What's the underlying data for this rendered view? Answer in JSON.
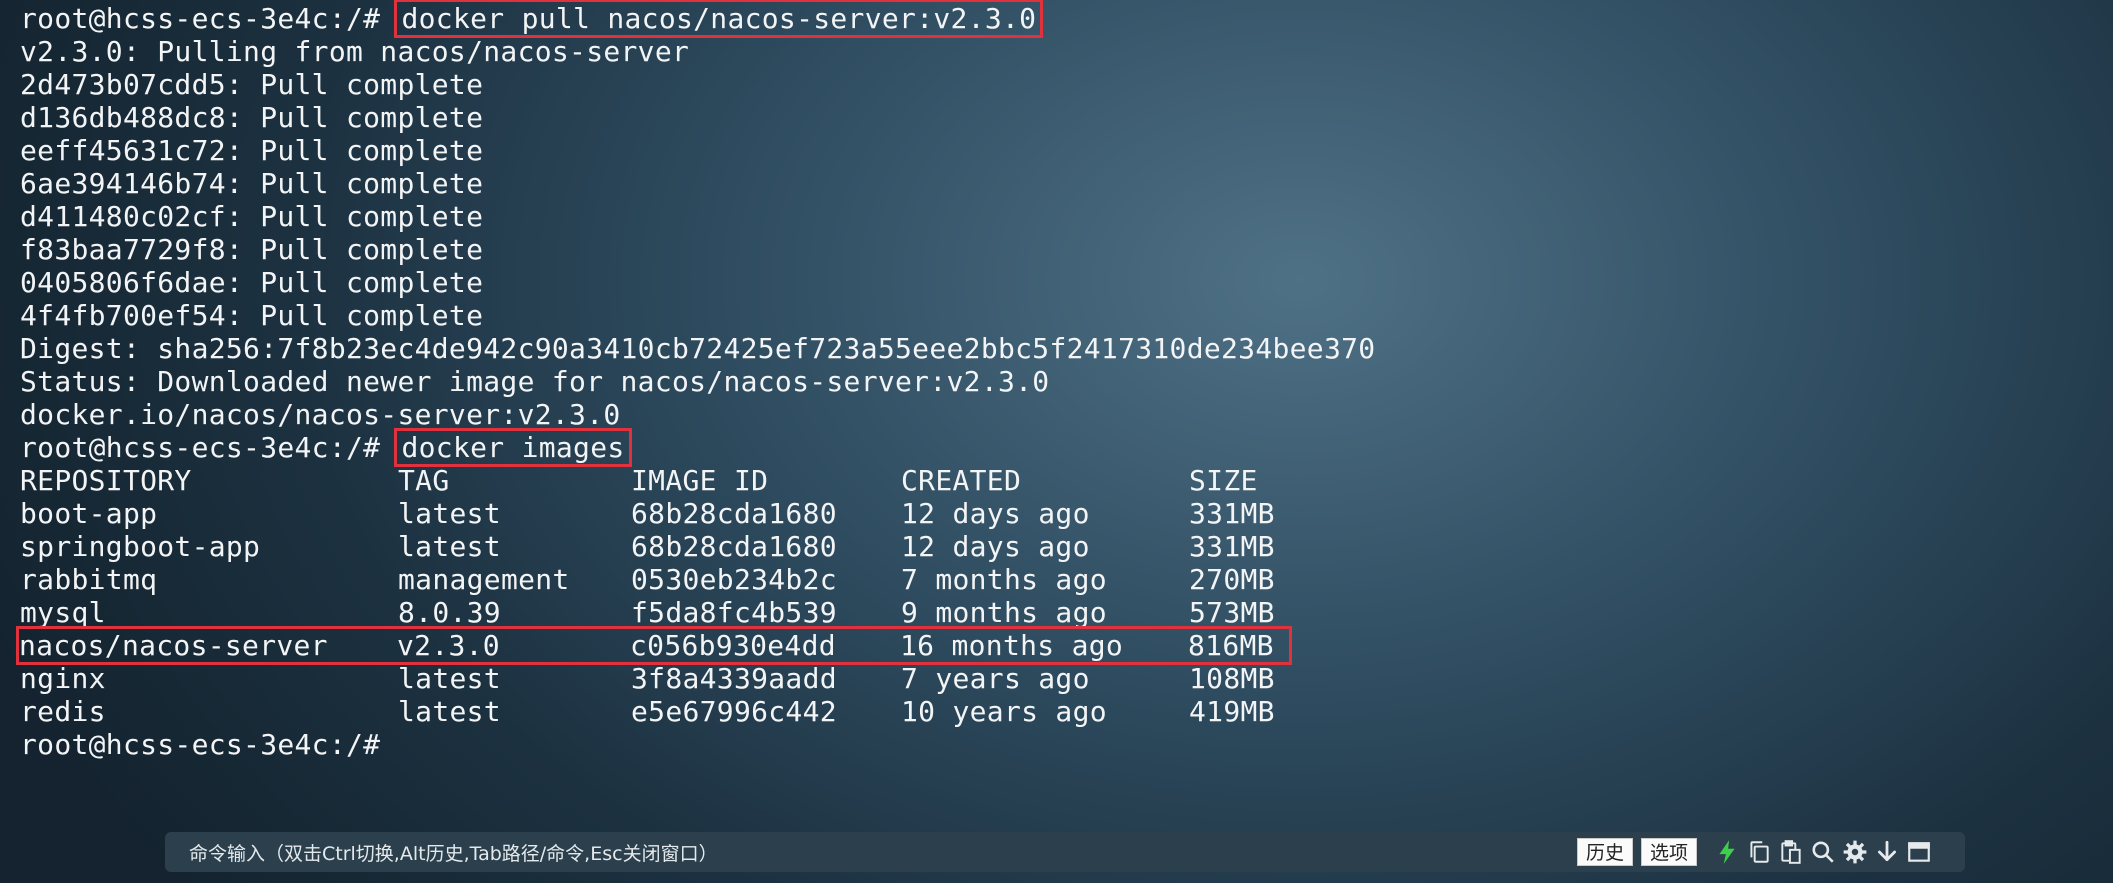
{
  "terminal": {
    "pull_prompt": "root@hcss-ecs-3e4c:/# ",
    "pull_command": "docker pull nacos/nacos-server:v2.3.0",
    "pull_output": [
      "v2.3.0: Pulling from nacos/nacos-server",
      "2d473b07cdd5: Pull complete",
      "d136db488dc8: Pull complete",
      "eeff45631c72: Pull complete",
      "6ae394146b74: Pull complete",
      "d411480c02cf: Pull complete",
      "f83baa7729f8: Pull complete",
      "0405806f6dae: Pull complete",
      "4f4fb700ef54: Pull complete",
      "Digest: sha256:7f8b23ec4de942c90a3410cb72425ef723a55eee2bbc5f2417310de234bee370",
      "Status: Downloaded newer image for nacos/nacos-server:v2.3.0",
      "docker.io/nacos/nacos-server:v2.3.0"
    ],
    "images_prompt": "root@hcss-ecs-3e4c:/# ",
    "images_command": "docker images",
    "images_table": {
      "headers": [
        "REPOSITORY",
        "TAG",
        "IMAGE ID",
        "CREATED",
        "SIZE"
      ],
      "rows": [
        [
          "boot-app",
          "latest",
          "68b28cda1680",
          "12 days ago",
          "331MB"
        ],
        [
          "springboot-app",
          "latest",
          "68b28cda1680",
          "12 days ago",
          "331MB"
        ],
        [
          "rabbitmq",
          "management",
          "0530eb234b2c",
          "7 months ago",
          "270MB"
        ],
        [
          "mysql",
          "8.0.39",
          "f5da8fc4b539",
          "9 months ago",
          "573MB"
        ],
        [
          "nacos/nacos-server",
          "v2.3.0",
          "c056b930e4dd",
          "16 months ago",
          "816MB"
        ],
        [
          "nginx",
          "latest",
          "3f8a4339aadd",
          "7 years ago",
          "108MB"
        ],
        [
          "redis",
          "latest",
          "e5e67996c442",
          "10 years ago",
          "419MB"
        ]
      ]
    },
    "final_prompt": "root@hcss-ecs-3e4c:/#"
  },
  "statusbar": {
    "hint": "命令输入（双击Ctrl切换,Alt历史,Tab路径/命令,Esc关闭窗口）",
    "history_label": "历史",
    "options_label": "选项"
  },
  "icons": [
    "lightning-icon",
    "copy-icon",
    "paste-icon",
    "search-icon",
    "gear-icon",
    "download-icon",
    "window-icon"
  ],
  "colors": {
    "highlight": "#e0313c",
    "lightning": "#3ecf4a"
  }
}
